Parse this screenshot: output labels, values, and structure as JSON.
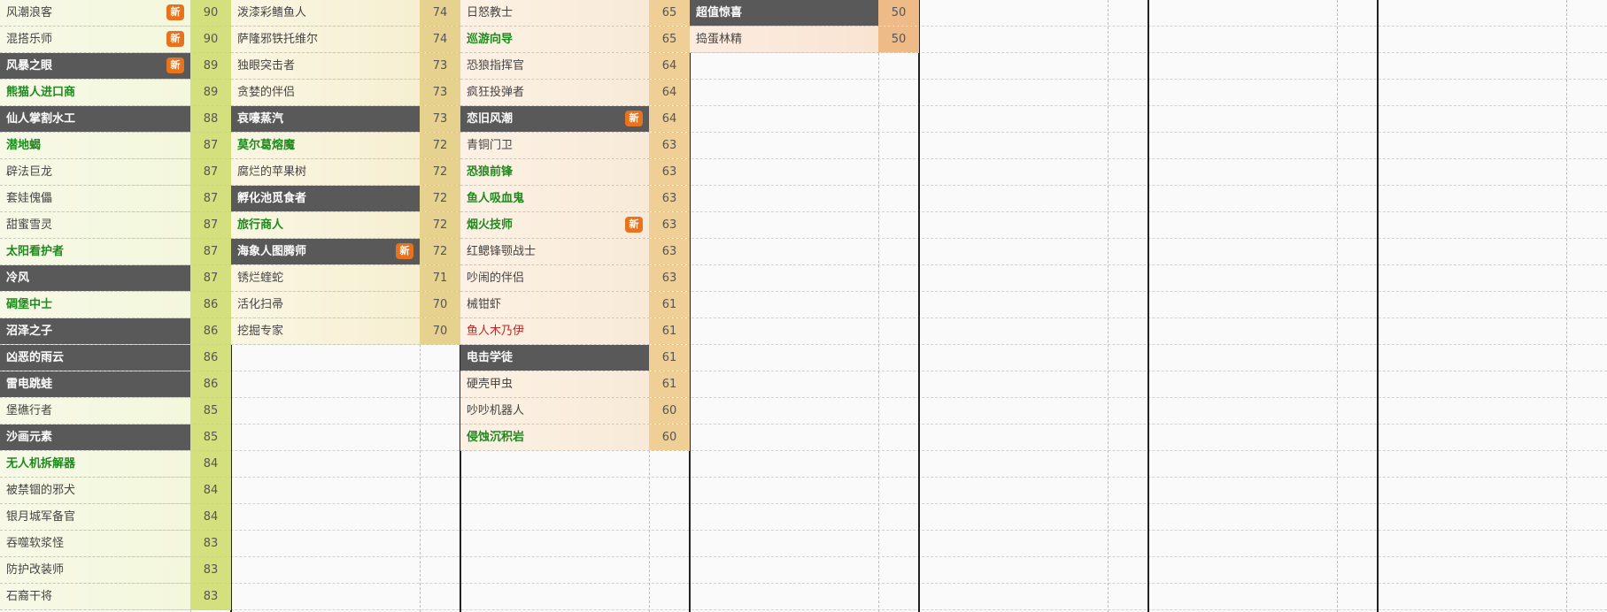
{
  "columns": [
    {
      "score_bg": "#d4df7e",
      "name_bg": "linear-gradient(90deg,#f7f9e6,#f3f7dc)",
      "rows": [
        {
          "name": "风潮浪客",
          "score": "90",
          "badge": "新",
          "style": "normal"
        },
        {
          "name": "混搭乐师",
          "score": "90",
          "badge": "新",
          "style": "normal"
        },
        {
          "name": "风暴之眼",
          "score": "89",
          "badge": "新",
          "style": "dark"
        },
        {
          "name": "熊猫人进口商",
          "score": "89",
          "badge": "",
          "style": "green"
        },
        {
          "name": "仙人掌割水工",
          "score": "88",
          "badge": "",
          "style": "dark"
        },
        {
          "name": "潜地蝎",
          "score": "87",
          "badge": "",
          "style": "green"
        },
        {
          "name": "辟法巨龙",
          "score": "87",
          "badge": "",
          "style": "normal"
        },
        {
          "name": "套娃傀儡",
          "score": "87",
          "badge": "",
          "style": "normal"
        },
        {
          "name": "甜蜜雪灵",
          "score": "87",
          "badge": "",
          "style": "normal"
        },
        {
          "name": "太阳看护者",
          "score": "87",
          "badge": "",
          "style": "green"
        },
        {
          "name": "冷风",
          "score": "87",
          "badge": "",
          "style": "dark"
        },
        {
          "name": "碉堡中士",
          "score": "86",
          "badge": "",
          "style": "green"
        },
        {
          "name": "沼泽之子",
          "score": "86",
          "badge": "",
          "style": "dark"
        },
        {
          "name": "凶恶的雨云",
          "score": "86",
          "badge": "",
          "style": "dark"
        },
        {
          "name": "雷电跳蛙",
          "score": "86",
          "badge": "",
          "style": "dark"
        },
        {
          "name": "堡礁行者",
          "score": "85",
          "badge": "",
          "style": "normal"
        },
        {
          "name": "沙画元素",
          "score": "85",
          "badge": "",
          "style": "dark"
        },
        {
          "name": "无人机拆解器",
          "score": "84",
          "badge": "",
          "style": "green"
        },
        {
          "name": "被禁锢的邪犬",
          "score": "84",
          "badge": "",
          "style": "normal"
        },
        {
          "name": "银月城军备官",
          "score": "84",
          "badge": "",
          "style": "normal"
        },
        {
          "name": "吞噬软浆怪",
          "score": "83",
          "badge": "",
          "style": "normal"
        },
        {
          "name": "防护改装师",
          "score": "83",
          "badge": "",
          "style": "normal"
        },
        {
          "name": "石裔干将",
          "score": "83",
          "badge": "",
          "style": "normal"
        }
      ]
    },
    {
      "score_bg": "#e6d18e",
      "name_bg": "linear-gradient(90deg,#faf6e2,#f6efd2)",
      "rows": [
        {
          "name": "泼漆彩鳍鱼人",
          "score": "74",
          "badge": "",
          "style": "normal"
        },
        {
          "name": "萨隆邪铁托维尔",
          "score": "74",
          "badge": "",
          "style": "normal"
        },
        {
          "name": "独眼突击者",
          "score": "73",
          "badge": "",
          "style": "normal"
        },
        {
          "name": "贪婪的伴侣",
          "score": "73",
          "badge": "",
          "style": "normal"
        },
        {
          "name": "哀嚎蒸汽",
          "score": "73",
          "badge": "",
          "style": "dark"
        },
        {
          "name": "莫尔葛熔魔",
          "score": "72",
          "badge": "",
          "style": "green"
        },
        {
          "name": "腐烂的苹果树",
          "score": "72",
          "badge": "",
          "style": "normal"
        },
        {
          "name": "孵化池觅食者",
          "score": "72",
          "badge": "",
          "style": "dark"
        },
        {
          "name": "旅行商人",
          "score": "72",
          "badge": "",
          "style": "green"
        },
        {
          "name": "海象人图腾师",
          "score": "72",
          "badge": "新",
          "style": "dark"
        },
        {
          "name": "锈烂蝰蛇",
          "score": "71",
          "badge": "",
          "style": "normal"
        },
        {
          "name": "活化扫帚",
          "score": "70",
          "badge": "",
          "style": "normal"
        },
        {
          "name": "挖掘专家",
          "score": "70",
          "badge": "",
          "style": "normal"
        }
      ]
    },
    {
      "score_bg": "#efcf96",
      "name_bg": "linear-gradient(90deg,#fcf1e4,#f8ead8)",
      "rows": [
        {
          "name": "日怒教士",
          "score": "65",
          "badge": "",
          "style": "normal"
        },
        {
          "name": "巡游向导",
          "score": "65",
          "badge": "",
          "style": "green"
        },
        {
          "name": "恐狼指挥官",
          "score": "64",
          "badge": "",
          "style": "normal"
        },
        {
          "name": "疯狂投弹者",
          "score": "64",
          "badge": "",
          "style": "normal"
        },
        {
          "name": "恋旧风潮",
          "score": "64",
          "badge": "新",
          "style": "dark"
        },
        {
          "name": "青铜门卫",
          "score": "63",
          "badge": "",
          "style": "normal"
        },
        {
          "name": "恐狼前锋",
          "score": "63",
          "badge": "",
          "style": "green"
        },
        {
          "name": "鱼人吸血鬼",
          "score": "63",
          "badge": "",
          "style": "green"
        },
        {
          "name": "烟火技师",
          "score": "63",
          "badge": "新",
          "style": "green"
        },
        {
          "name": "红鳃锋颚战士",
          "score": "63",
          "badge": "",
          "style": "normal"
        },
        {
          "name": "吵闹的伴侣",
          "score": "63",
          "badge": "",
          "style": "normal"
        },
        {
          "name": "械钳虾",
          "score": "61",
          "badge": "",
          "style": "normal"
        },
        {
          "name": "鱼人木乃伊",
          "score": "61",
          "badge": "",
          "style": "red"
        },
        {
          "name": "电击学徒",
          "score": "61",
          "badge": "",
          "style": "dark"
        },
        {
          "name": "硬壳甲虫",
          "score": "61",
          "badge": "",
          "style": "normal"
        },
        {
          "name": "吵吵机器人",
          "score": "60",
          "badge": "",
          "style": "normal"
        },
        {
          "name": "侵蚀沉积岩",
          "score": "60",
          "badge": "",
          "style": "green"
        }
      ]
    },
    {
      "score_bg": "#eebb88",
      "name_bg": "linear-gradient(90deg,#fcece0,#f9e4d2)",
      "rows": [
        {
          "name": "超值惊喜",
          "score": "50",
          "badge": "",
          "style": "dark"
        },
        {
          "name": "捣蛋林精",
          "score": "50",
          "badge": "",
          "style": "normal"
        }
      ]
    }
  ]
}
